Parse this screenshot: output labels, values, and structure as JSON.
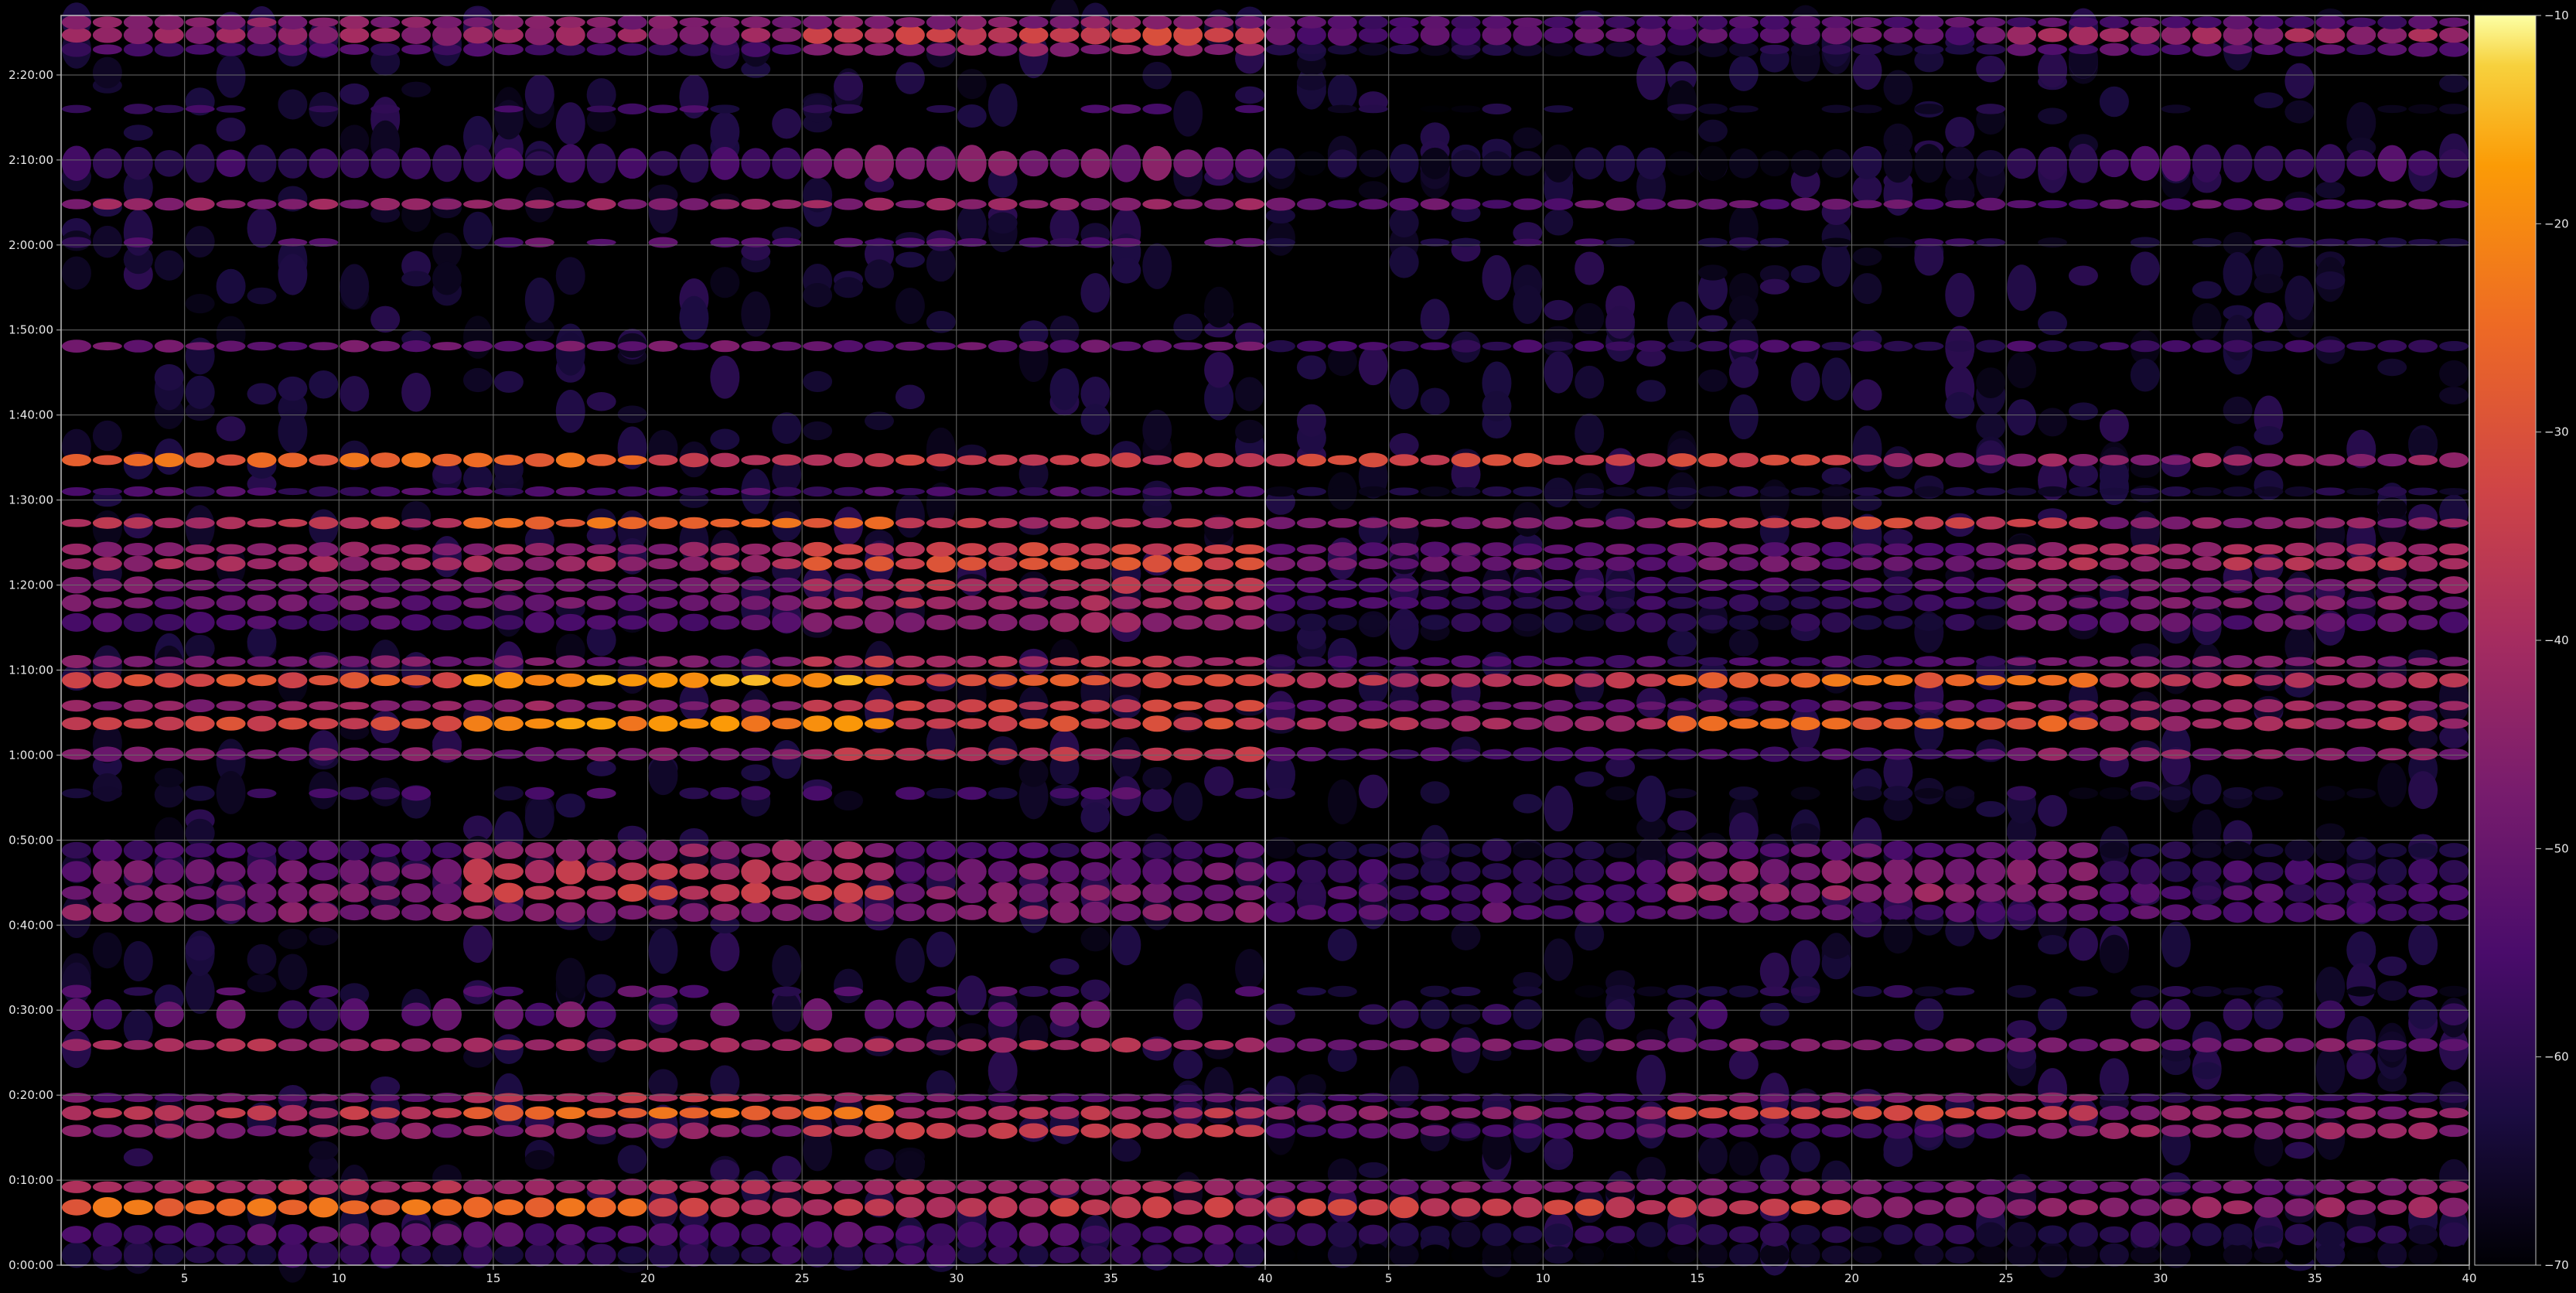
{
  "chart_data": {
    "type": "heatmap",
    "title": "",
    "xlabel": "",
    "ylabel": "",
    "grid": true,
    "colormap": "inferno",
    "colors": {
      "background": "#000000",
      "grid": "#6a6a6a",
      "axes": "#bfbfbf",
      "text": "#e8e8e8"
    },
    "panels": [
      {
        "name": "left",
        "xlim": [
          1,
          40
        ]
      },
      {
        "name": "right",
        "xlim": [
          1,
          40
        ]
      }
    ],
    "x_ticks": [
      5,
      10,
      15,
      20,
      25,
      30,
      35,
      40
    ],
    "x_tick_labels": [
      "5",
      "10",
      "15",
      "20",
      "25",
      "30",
      "35",
      "40"
    ],
    "y_ticks_minutes": [
      0,
      10,
      20,
      30,
      40,
      50,
      60,
      70,
      80,
      90,
      100,
      110,
      120,
      130,
      140
    ],
    "y_tick_labels": [
      "0:00:00",
      "0:10:00",
      "0:20:00",
      "0:30:00",
      "0:40:00",
      "0:50:00",
      "1:00:00",
      "1:10:00",
      "1:20:00",
      "1:30:00",
      "1:40:00",
      "1:50:00",
      "2:00:00",
      "2:10:00",
      "2:20:00"
    ],
    "ylim_minutes": [
      0,
      147
    ],
    "colorbar": {
      "range": [
        -70,
        -10
      ],
      "ticks": [
        -10,
        -20,
        -30,
        -40,
        -50,
        -60,
        -70
      ],
      "tick_labels": [
        "−10",
        "−20",
        "−30",
        "−40",
        "−50",
        "−60",
        "−70"
      ]
    },
    "rows_minutes": [
      {
        "t": 1.2,
        "base": -60,
        "h": 2.4,
        "profile": "flat"
      },
      {
        "t": 3.6,
        "base": -54,
        "h": 2.4,
        "profile": "flat"
      },
      {
        "t": 6.8,
        "base": -34,
        "h": 2.0,
        "profile": "early"
      },
      {
        "t": 9.2,
        "base": -40,
        "h": 1.6,
        "profile": "flat"
      },
      {
        "t": 15.8,
        "base": -42,
        "h": 1.6,
        "profile": "late"
      },
      {
        "t": 17.9,
        "base": -36,
        "h": 1.5,
        "profile": "mid"
      },
      {
        "t": 19.7,
        "base": -48,
        "h": 1.0,
        "profile": "mid"
      },
      {
        "t": 25.9,
        "base": -40,
        "h": 1.4,
        "profile": "flat"
      },
      {
        "t": 29.5,
        "base": -57,
        "h": 3.0,
        "profile": "scatter"
      },
      {
        "t": 32.2,
        "base": -60,
        "h": 1.2,
        "profile": "scatter"
      },
      {
        "t": 41.5,
        "base": -46,
        "h": 2.0,
        "profile": "flat"
      },
      {
        "t": 43.8,
        "base": -46,
        "h": 2.0,
        "profile": "mid"
      },
      {
        "t": 46.3,
        "base": -48,
        "h": 2.4,
        "profile": "mid"
      },
      {
        "t": 48.8,
        "base": -54,
        "h": 2.0,
        "profile": "mid"
      },
      {
        "t": 55.5,
        "base": -62,
        "h": 1.4,
        "profile": "scatter"
      },
      {
        "t": 60.1,
        "base": -44,
        "h": 1.4,
        "profile": "late"
      },
      {
        "t": 63.7,
        "base": -30,
        "h": 1.5,
        "profile": "mid"
      },
      {
        "t": 65.8,
        "base": -40,
        "h": 1.2,
        "profile": "late"
      },
      {
        "t": 68.8,
        "base": -28,
        "h": 1.5,
        "profile": "mid"
      },
      {
        "t": 71.0,
        "base": -44,
        "h": 1.2,
        "profile": "late"
      },
      {
        "t": 75.6,
        "base": -50,
        "h": 2.0,
        "profile": "late"
      },
      {
        "t": 77.9,
        "base": -46,
        "h": 1.6,
        "profile": "late"
      },
      {
        "t": 80.0,
        "base": -44,
        "h": 1.6,
        "profile": "late"
      },
      {
        "t": 82.5,
        "base": -38,
        "h": 1.6,
        "profile": "late"
      },
      {
        "t": 84.2,
        "base": -40,
        "h": 1.4,
        "profile": "late"
      },
      {
        "t": 87.3,
        "base": -36,
        "h": 1.2,
        "profile": "mid"
      },
      {
        "t": 91.0,
        "base": -56,
        "h": 1.0,
        "profile": "flat"
      },
      {
        "t": 94.7,
        "base": -34,
        "h": 1.4,
        "profile": "early"
      },
      {
        "t": 108.1,
        "base": -50,
        "h": 1.2,
        "profile": "flat"
      },
      {
        "t": 120.3,
        "base": -58,
        "h": 1.0,
        "profile": "scatter"
      },
      {
        "t": 124.8,
        "base": -44,
        "h": 1.2,
        "profile": "flat"
      },
      {
        "t": 129.6,
        "base": -54,
        "h": 3.6,
        "profile": "late"
      },
      {
        "t": 136.0,
        "base": -62,
        "h": 1.0,
        "profile": "scatter"
      },
      {
        "t": 143.0,
        "base": -52,
        "h": 1.4,
        "profile": "late"
      },
      {
        "t": 144.7,
        "base": -40,
        "h": 2.0,
        "profile": "late"
      },
      {
        "t": 146.2,
        "base": -46,
        "h": 1.4,
        "profile": "flat"
      }
    ]
  }
}
